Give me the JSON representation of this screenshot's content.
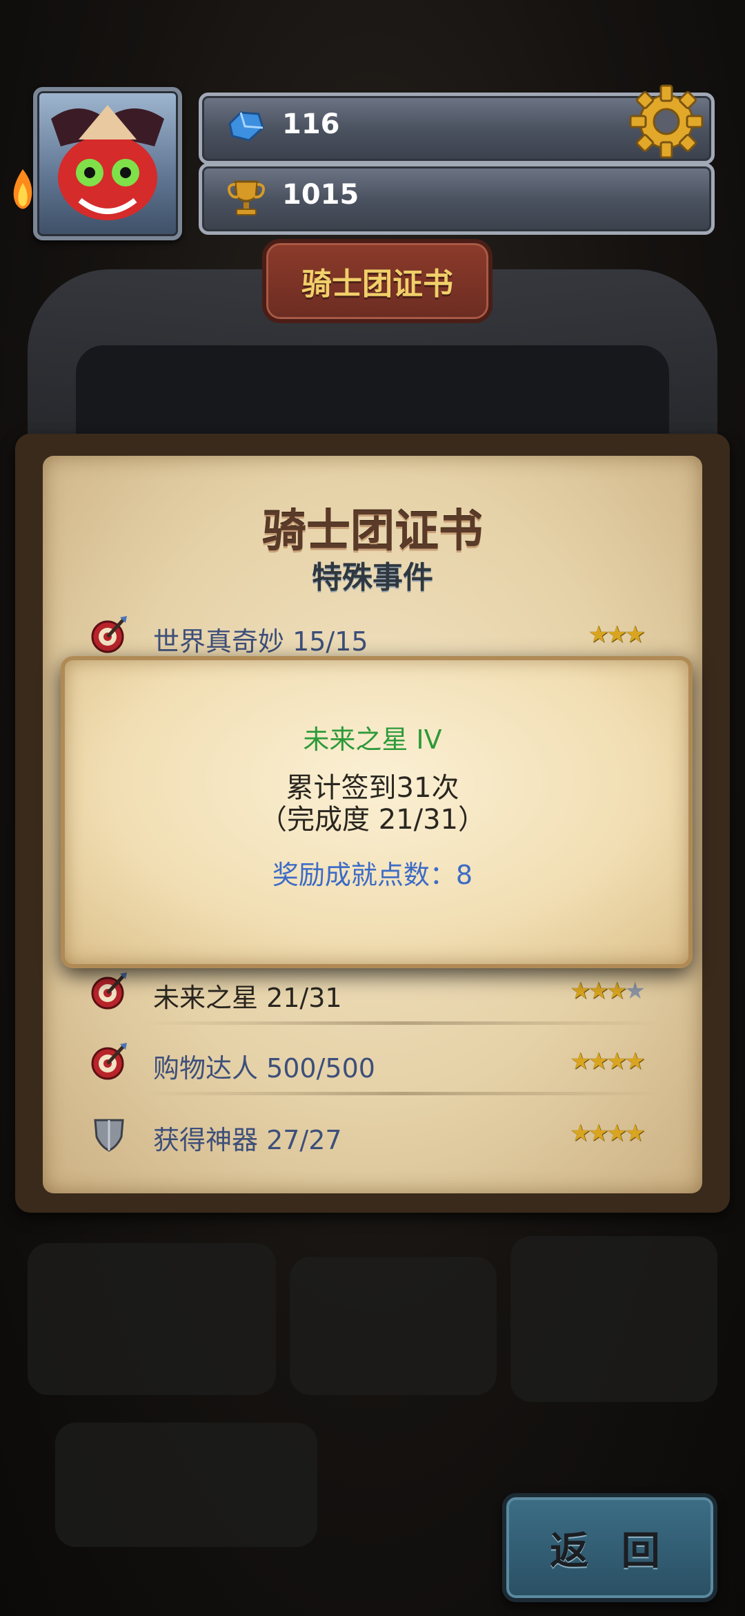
{
  "header": {
    "gems": "116",
    "trophies": "1015",
    "banner_title": "骑士团证书"
  },
  "board": {
    "title": "骑士团证书",
    "subtitle": "特殊事件"
  },
  "achievements": [
    {
      "label": "世界真奇妙 15/15",
      "icon": "target-arrow-icon",
      "stars_filled": 3,
      "stars_total": 3
    },
    {
      "label": "未来之星 21/31",
      "icon": "target-arrow-icon",
      "stars_filled": 3,
      "stars_total": 4
    },
    {
      "label": "购物达人 500/500",
      "icon": "target-arrow-icon",
      "stars_filled": 4,
      "stars_total": 4
    },
    {
      "label": "获得神器 27/27",
      "icon": "shield-icon",
      "stars_filled": 4,
      "stars_total": 4
    }
  ],
  "popup": {
    "name": "未来之星 IV",
    "desc_line1": "累计签到31次",
    "desc_line2": "（完成度 21/31）",
    "reward": "奖励成就点数：8"
  },
  "back_button": "返 回",
  "colors": {
    "label_blue": "#3d4f7a",
    "name_green": "#2e9a3a",
    "reward_blue": "#3d6bc6",
    "star_gold": "#d9a520",
    "star_grey": "#8b93a3"
  }
}
